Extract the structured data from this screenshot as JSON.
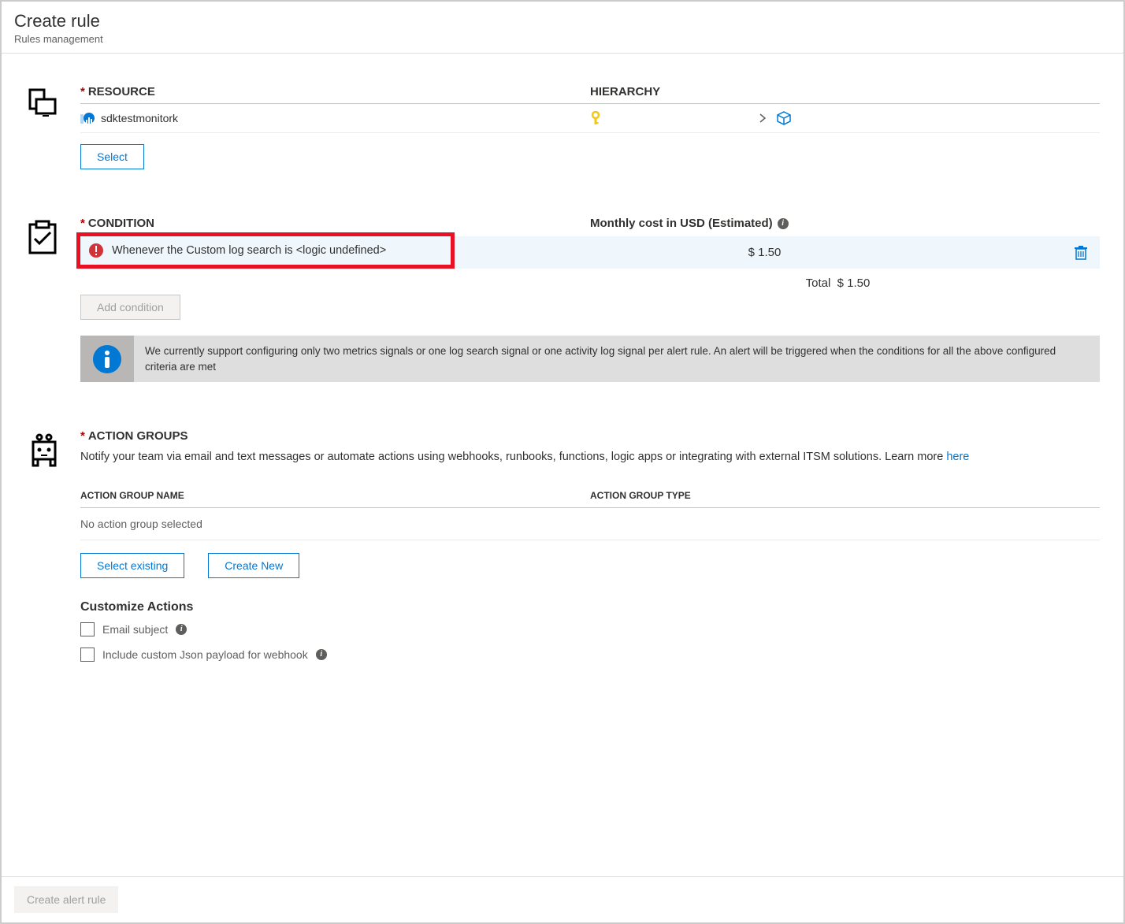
{
  "header": {
    "title": "Create rule",
    "subtitle": "Rules management"
  },
  "resource": {
    "heading": "RESOURCE",
    "hierarchy_heading": "HIERARCHY",
    "name": "sdktestmonitork",
    "select_button": "Select"
  },
  "condition": {
    "heading": "CONDITION",
    "cost_heading": "Monthly cost in USD (Estimated)",
    "item_text": "Whenever the Custom log search is <logic undefined>",
    "item_cost": "$ 1.50",
    "total_label": "Total",
    "total_value": "$ 1.50",
    "add_button": "Add condition",
    "info_text": "We currently support configuring only two metrics signals or one log search signal or one activity log signal per alert rule. An alert will be triggered when the conditions for all the above configured criteria are met"
  },
  "action_groups": {
    "heading": "ACTION GROUPS",
    "description": "Notify your team via email and text messages or automate actions using webhooks, runbooks, functions, logic apps or integrating with external ITSM solutions. Learn more ",
    "learn_more": "here",
    "col_name": "ACTION GROUP NAME",
    "col_type": "ACTION GROUP TYPE",
    "empty": "No action group selected",
    "select_existing": "Select existing",
    "create_new": "Create New",
    "customize_heading": "Customize Actions",
    "email_subject": "Email subject",
    "custom_json": "Include custom Json payload for webhook"
  },
  "footer": {
    "create_button": "Create alert rule"
  }
}
